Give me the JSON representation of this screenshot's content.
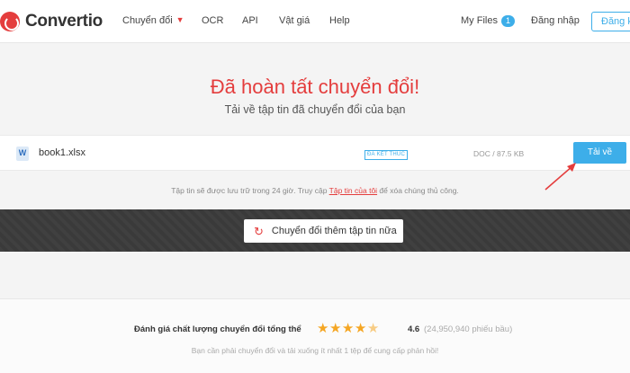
{
  "header": {
    "logo_text": "Convertio",
    "nav": [
      {
        "label": "Chuyển đổi"
      },
      {
        "label": "OCR"
      },
      {
        "label": "API"
      },
      {
        "label": "Vật giá"
      },
      {
        "label": "Help"
      }
    ],
    "my_files_label": "My Files",
    "my_files_count": "1",
    "login_label": "Đăng nhập",
    "register_label": "Đăng k"
  },
  "main": {
    "title": "Đã hoàn tất chuyển đổi!",
    "subtitle": "Tải về tập tin đã chuyển đổi của bạn",
    "file": {
      "name": "book1.xlsx",
      "status": "ĐÃ KẾT THÚC",
      "meta": "DOC / 87.5 KB",
      "download_label": "Tải về"
    },
    "notice_prefix": "Tập tin sẽ được lưu trữ trong 24 giờ. Truy cập ",
    "notice_link": "Tập tin của tôi",
    "notice_suffix": " để xóa chúng thủ công.",
    "convert_more_label": "Chuyển đổi thêm tập tin nữa"
  },
  "rating": {
    "label": "Đánh giá chất lượng chuyển đổi tổng thể",
    "score": "4.6",
    "count": "(24,950,940 phiếu bầu)",
    "note": "Bạn cần phải chuyển đổi và tải xuống ít nhất 1 tệp để cung cấp phản hồi!",
    "value": 4.6,
    "max": 5
  },
  "colors": {
    "brand_red": "#e43d3d",
    "accent_blue": "#3daee9",
    "star": "#f5a623"
  }
}
